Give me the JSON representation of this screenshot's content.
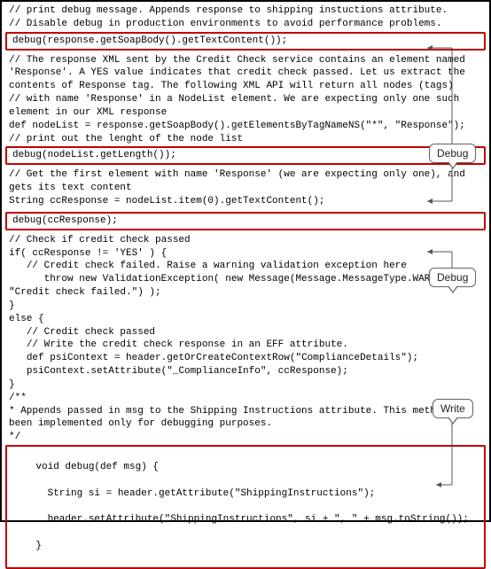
{
  "code": {
    "c1": "// print debug message. Appends response to shipping instuctions attribute.",
    "c2": "// Disable debug in production environments to avoid performance problems.",
    "h1": "debug(response.getSoapBody().getTextContent());",
    "c3": "// The response XML sent by the Credit Check service contains an element named 'Response'. A YES value indicates that credit check passed. Let us extract the contents of Response tag. The following XML API will return all nodes (tags)",
    "c4": "// with name 'Response' in a NodeList element. We are expecting only one such element in our XML response",
    "c5": "def nodeList = response.getSoapBody().getElementsByTagNameNS(\"*\", \"Response\");",
    "c6": "// print out the lenght of the node list",
    "h2": "debug(nodeList.getLength());",
    "c7": "// Get the first element with name 'Response' (we are expecting only one), and gets its text content",
    "c8": "String ccResponse = nodeList.item(0).getTextContent();",
    "h3": "debug(ccResponse);",
    "c9": "// Check if credit check passed",
    "c10": "if( ccResponse != 'YES' ) {",
    "c11": "   // Credit check failed. Raise a warning validation exception here",
    "c12": "      throw new ValidationException( new Message(Message.MessageType.WARNING, \"Credit check failed.\") );",
    "c13": "}",
    "c14": "else {",
    "c15": "   // Credit check passed",
    "c16": "   // Write the credit check response in an EFF attribute.",
    "c17": "   def psiContext = header.getOrCreateContextRow(\"ComplianceDetails\");",
    "c18": "   psiContext.setAttribute(\"_ComplianceInfo\", ccResponse);",
    "c19": "}",
    "c20": "/**",
    "c21": "* Appends passed in msg to the Shipping Instructions attribute. This method has been implemented only for debugging purposes.",
    "c22": "*/",
    "h4a": "void debug(def msg) {",
    "h4b": "  String si = header.getAttribute(\"ShippingInstructions\");",
    "h4c": "  header.setAttribute(\"ShippingInstructions\", si + \", \" + msg.toString());",
    "h4d": "}"
  },
  "callouts": {
    "debug1": "Debug",
    "debug2": "Debug",
    "write": "Write"
  }
}
